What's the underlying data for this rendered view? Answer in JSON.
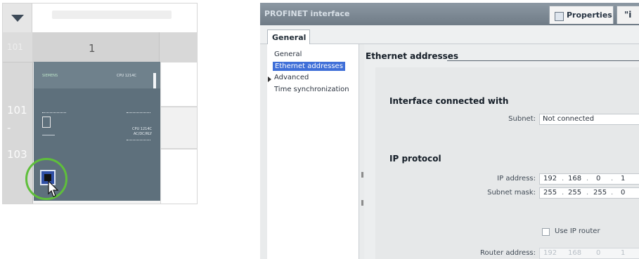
{
  "device_view": {
    "column_number": "1",
    "left_header_label": "101",
    "row_labels": [
      "101",
      "-",
      "103"
    ],
    "plc": {
      "left_label": "SIEMENS",
      "right_label": "CPU 1214C",
      "text_lines": [
        "CPU 1214C",
        "AC/DC/RLY"
      ]
    },
    "highlight_color": "#5fbf3b"
  },
  "inspector": {
    "window_title": "PROFINET interface",
    "properties_tab": "Properties",
    "info_tab": "\"i",
    "general_tab": "General",
    "nav_items": [
      {
        "label": "General",
        "selected": false
      },
      {
        "label": "Ethernet addresses",
        "selected": true
      },
      {
        "label": "Advanced",
        "selected": false,
        "expandable": true
      },
      {
        "label": "Time synchronization",
        "selected": false
      }
    ],
    "section_title": "Ethernet addresses",
    "interface_heading": "Interface connected with",
    "subnet_label": "Subnet:",
    "subnet_value": "Not connected",
    "ip_heading": "IP protocol",
    "ip_label": "IP address:",
    "ip_octets": [
      "192",
      "168",
      "0",
      "1"
    ],
    "mask_label": "Subnet mask:",
    "mask_octets": [
      "255",
      "255",
      "255",
      "0"
    ],
    "use_router_label": "Use IP router",
    "use_router_checked": false,
    "router_label": "Router address:",
    "router_octets": [
      "192",
      "168",
      "0",
      "1"
    ],
    "selection_color": "#3f6fd8"
  }
}
